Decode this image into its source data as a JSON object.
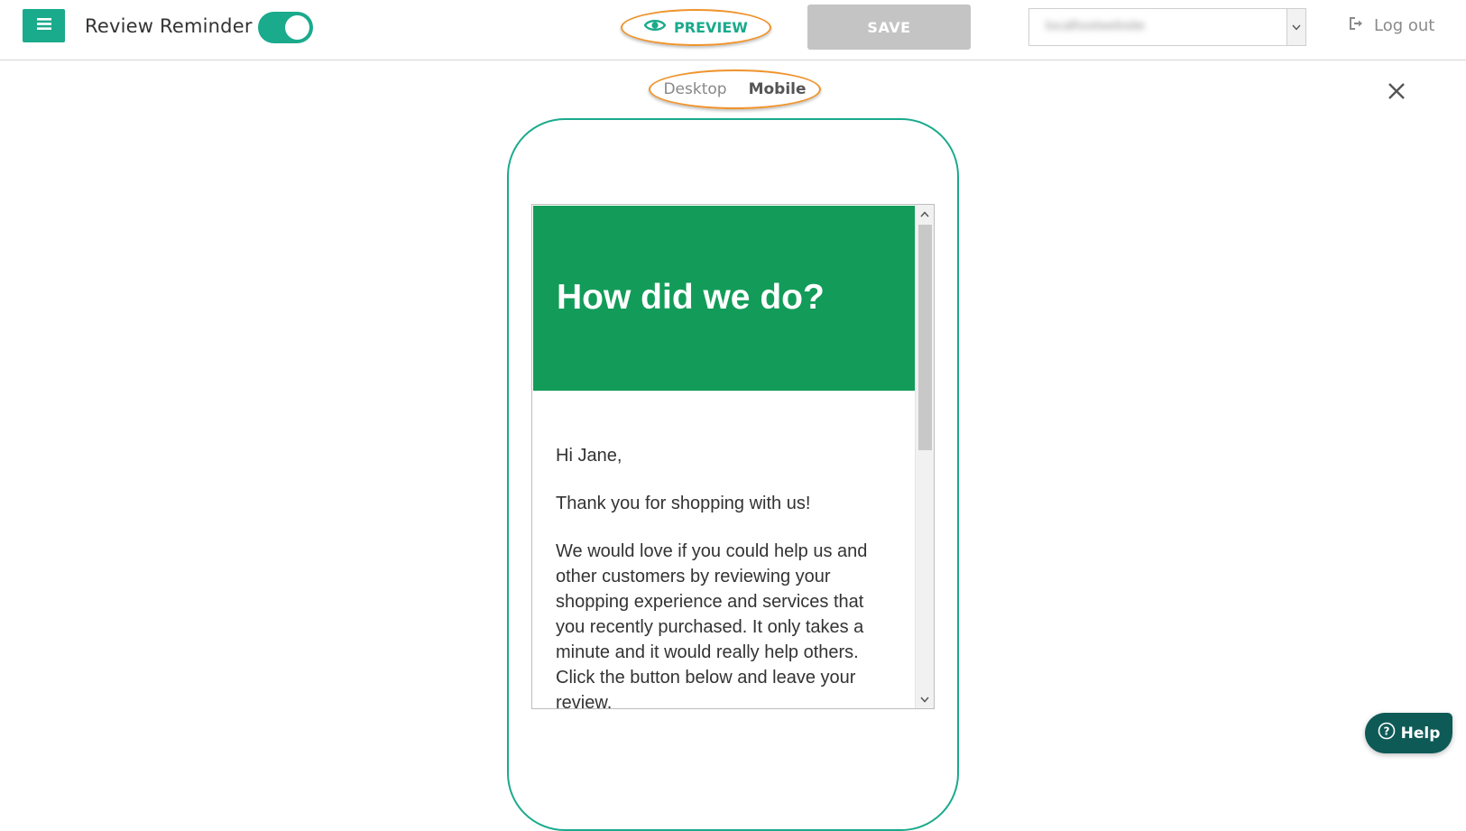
{
  "header": {
    "menu_icon": "hamburger-menu-icon",
    "app_title": "Review Reminder",
    "toggle_state": "on",
    "preview": {
      "label": "PREVIEW",
      "icon": "eye-icon"
    },
    "save_label": "SAVE",
    "site_select": {
      "selected": "localhostwebsite",
      "icon": "chevron-down-icon"
    },
    "logout": {
      "label": "Log out",
      "icon": "sign-out-icon"
    }
  },
  "view_switch": {
    "desktop_label": "Desktop",
    "mobile_label": "Mobile",
    "active": "Mobile"
  },
  "close_icon": "close-icon",
  "email": {
    "heading": "How did we do?",
    "greeting": "Hi Jane,",
    "thanks": "Thank you for shopping with us!",
    "body": "We would love if you could help us and other customers by reviewing your shopping experience and services that you recently purchased. It only takes a minute and it would really help others. Click the button below and leave your review."
  },
  "help": {
    "label": "Help",
    "icon": "question-circle-icon"
  },
  "colors": {
    "accent": "#1aaa8c",
    "highlight_outline": "#f0932b",
    "email_header_bg": "#139c59",
    "save_disabled": "#c4c4c4",
    "help_bg": "#0e5a56"
  }
}
